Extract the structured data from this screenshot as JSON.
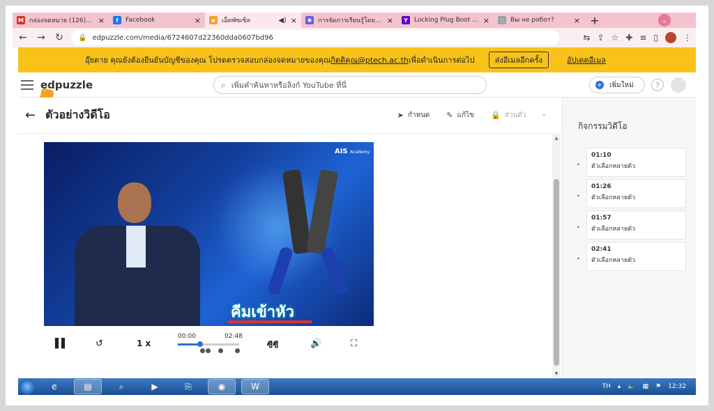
{
  "browser": {
    "tabs": [
      {
        "title": "กล่องจดหมาย (126) - a...",
        "favicon_color": "#d93025",
        "favicon_glyph": "M"
      },
      {
        "title": "Facebook",
        "favicon_color": "#1877f2",
        "favicon_glyph": "f"
      },
      {
        "title": "เอ็ดพัซเซิล",
        "favicon_color": "#f4a321",
        "favicon_glyph": "e",
        "audio_icon": "speaker-icon"
      },
      {
        "title": "การจัดการเรียนรู้โดยใช้ A...",
        "favicon_color": "#6c5ce7",
        "favicon_glyph": "✱"
      },
      {
        "title": "Locking Plug Boot - Ya...",
        "favicon_color": "#6001d2",
        "favicon_glyph": "Y"
      },
      {
        "title": "Вы не робот?",
        "favicon_color": "#9aa0a6",
        "favicon_glyph": "◌"
      }
    ],
    "url": "edpuzzle.com/media/6724607d22360dda0607bd96"
  },
  "banner": {
    "message": "อุ๊ยตาย คุณยังต้องยืนยันบัญชีของคุณ โปรดตรวจสอบกล่องจดหมายของคุณ",
    "email": "กิตติคุณ@ptech.ac.th",
    "message_tail": "เพื่อดำเนินการต่อไป",
    "resend_label": "ส่งอีเมลอีกครั้ง",
    "update_label": "อัปเดตอีเมล"
  },
  "header": {
    "brand": "edpuzzle",
    "search_placeholder": "เพิ่มคำค้นหาหรือลิงก์ YouTube ที่นี่",
    "new_label": "เพิ่มใหม่",
    "help_glyph": "?"
  },
  "page": {
    "title": "ตัวอย่างวิดีโอ",
    "actions": {
      "assign": "กำหนด",
      "edit": "แก้ไข",
      "private": "ส่วนตัว"
    }
  },
  "video": {
    "brand": "AIS",
    "brand_sub": "Academy",
    "caption": "คีมเข้าหัว",
    "progress_fraction": 0.36,
    "current_time": "00:00",
    "duration": "02:48",
    "speed": "1 x",
    "cc_label": "ซีซี"
  },
  "sidebar": {
    "title": "กิจกรรมวิดีโอ",
    "questions": [
      {
        "time": "01:10",
        "label": "ตัวเลือกหลายตัว"
      },
      {
        "time": "01:26",
        "label": "ตัวเลือกหลายตัว"
      },
      {
        "time": "01:57",
        "label": "ตัวเลือกหลายตัว"
      },
      {
        "time": "02:41",
        "label": "ตัวเลือกหลายตัว"
      }
    ]
  },
  "taskbar": {
    "language": "TH",
    "time": "12:32"
  }
}
